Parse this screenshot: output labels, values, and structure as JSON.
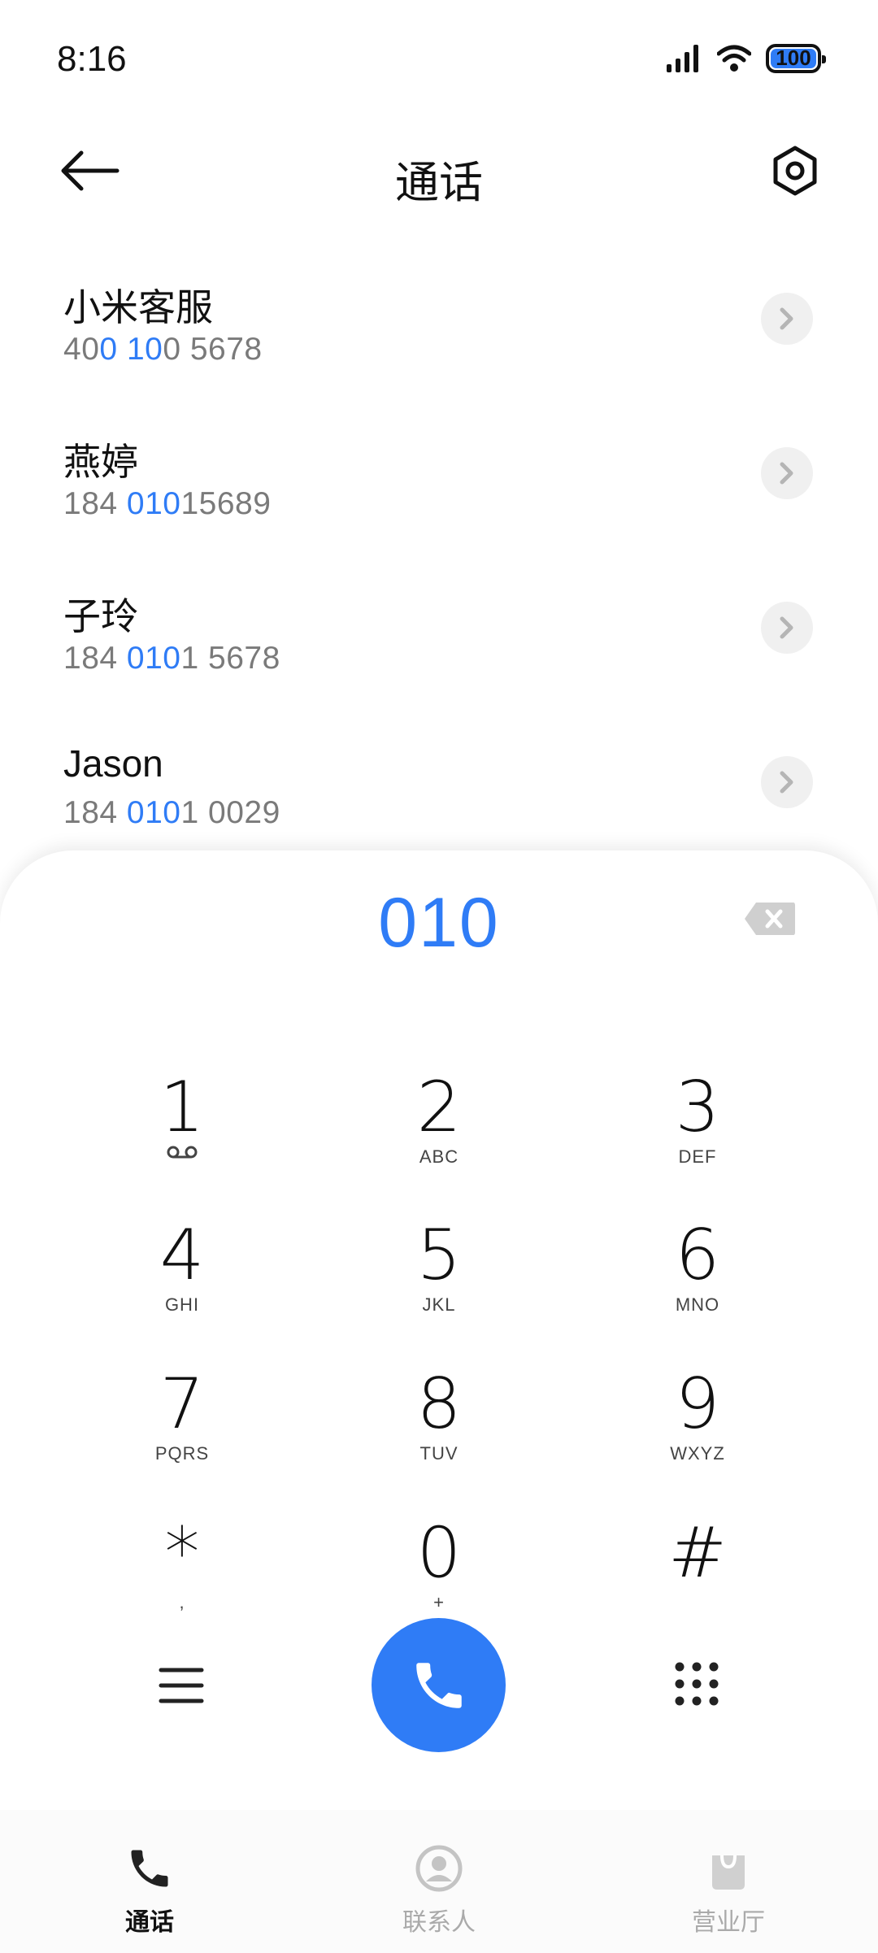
{
  "status_bar": {
    "time": "8:16",
    "battery": "100"
  },
  "header": {
    "title": "通话"
  },
  "results": [
    {
      "name": "小米客服",
      "number_parts": [
        {
          "t": "40",
          "h": false
        },
        {
          "t": "0",
          "h": true
        },
        {
          "t": " ",
          "h": false
        },
        {
          "t": "10",
          "h": true
        },
        {
          "t": "0 5678",
          "h": false
        }
      ]
    },
    {
      "name": "燕婷",
      "number_parts": [
        {
          "t": "184 ",
          "h": false
        },
        {
          "t": "010",
          "h": true
        },
        {
          "t": "15689",
          "h": false
        }
      ]
    },
    {
      "name": "子玲",
      "number_parts": [
        {
          "t": "184 ",
          "h": false
        },
        {
          "t": "010",
          "h": true
        },
        {
          "t": "1 5678",
          "h": false
        }
      ]
    },
    {
      "name": "Jason",
      "number_parts": [
        {
          "t": "184 ",
          "h": false
        },
        {
          "t": "010",
          "h": true
        },
        {
          "t": "1 0029",
          "h": false
        }
      ]
    }
  ],
  "dialpad": {
    "input": "010",
    "keys": [
      {
        "digit": "1",
        "letters": "",
        "voicemail": true
      },
      {
        "digit": "2",
        "letters": "ABC"
      },
      {
        "digit": "3",
        "letters": "DEF"
      },
      {
        "digit": "4",
        "letters": "GHI"
      },
      {
        "digit": "5",
        "letters": "JKL"
      },
      {
        "digit": "6",
        "letters": "MNO"
      },
      {
        "digit": "7",
        "letters": "PQRS"
      },
      {
        "digit": "8",
        "letters": "TUV"
      },
      {
        "digit": "9",
        "letters": "WXYZ"
      },
      {
        "digit": "*",
        "letters": ","
      },
      {
        "digit": "0",
        "letters": "+"
      },
      {
        "digit": "#",
        "letters": ""
      }
    ]
  },
  "tabs": [
    {
      "label": "通话",
      "icon": "phone-icon",
      "active": true
    },
    {
      "label": "联系人",
      "icon": "contact-icon",
      "active": false
    },
    {
      "label": "营业厅",
      "icon": "shopping-bag-icon",
      "active": false
    }
  ],
  "colors": {
    "accent": "#2f7cf6"
  }
}
